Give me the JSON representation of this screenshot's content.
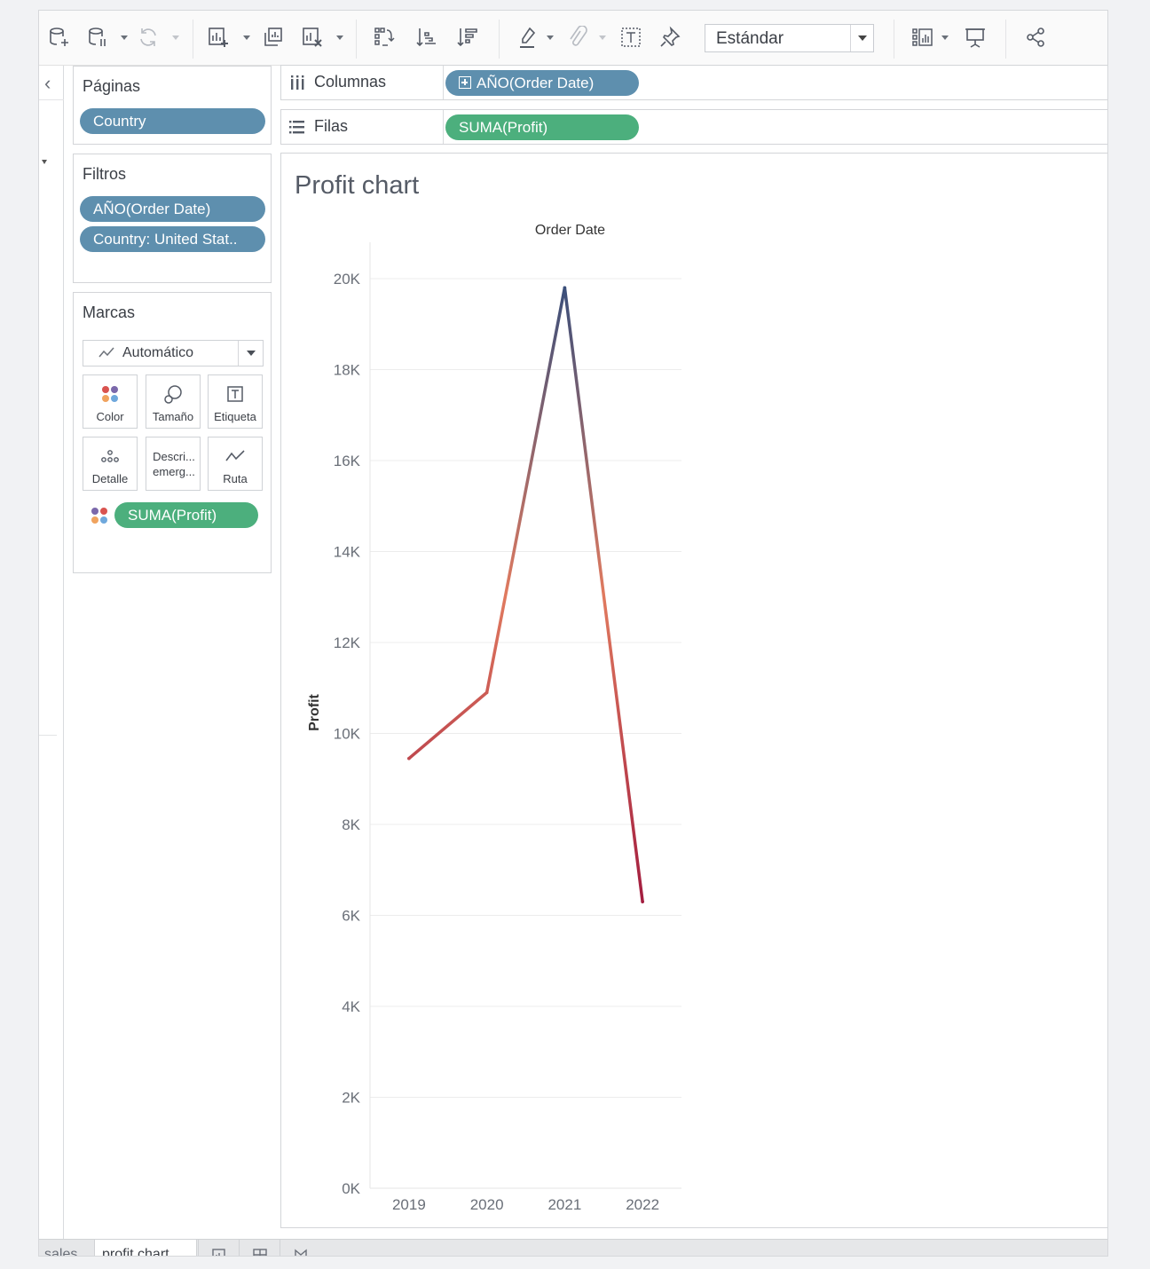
{
  "toolbar": {
    "fit_value": "Estándar"
  },
  "cards": {
    "pages": {
      "title": "Páginas",
      "pills": [
        "Country"
      ]
    },
    "filters": {
      "title": "Filtros",
      "pills": [
        "AÑO(Order Date)",
        "Country: United Stat.."
      ]
    },
    "marks": {
      "title": "Marcas",
      "type": "Automático",
      "buttons": {
        "color": "Color",
        "size": "Tamaño",
        "label": "Etiqueta",
        "detail": "Detalle",
        "tooltip_l1": "Descri...",
        "tooltip_l2": "emerg...",
        "path": "Ruta"
      },
      "color_pill": "SUMA(Profit)"
    }
  },
  "shelves": {
    "columns": {
      "label": "Columnas",
      "pill": "AÑO(Order Date)"
    },
    "rows": {
      "label": "Filas",
      "pill": "SUMA(Profit)"
    }
  },
  "view": {
    "title": "Profit chart"
  },
  "chart_data": {
    "type": "line",
    "title": "Profit chart",
    "x_header": "Order Date",
    "ylabel": "Profit",
    "categories": [
      "2019",
      "2020",
      "2021",
      "2022"
    ],
    "values": [
      9450,
      10900,
      19800,
      6300
    ],
    "ylim": [
      0,
      20000
    ],
    "y_ticks": [
      0,
      2000,
      4000,
      6000,
      8000,
      10000,
      12000,
      14000,
      16000,
      18000,
      20000
    ],
    "y_tick_labels": [
      "0K",
      "2K",
      "4K",
      "6K",
      "8K",
      "10K",
      "12K",
      "14K",
      "16K",
      "18K",
      "20K"
    ],
    "grid": true,
    "color_encoding": "SUMA(Profit)",
    "color_low": "#a31d3f",
    "color_mid": "#e07a5f",
    "color_high": "#3b4f7a"
  },
  "tabs": {
    "items": [
      "sales",
      "profit chart"
    ],
    "active": "profit chart"
  },
  "colors": {
    "pill_blue": "#5e8fae",
    "pill_green": "#4caf7d"
  }
}
